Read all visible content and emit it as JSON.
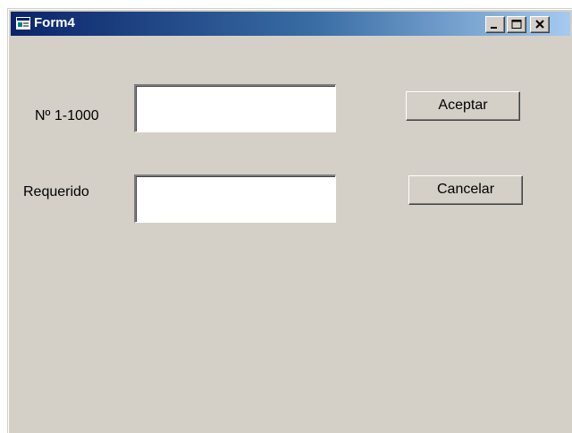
{
  "window": {
    "title": "Form4",
    "icon": "form-window-icon",
    "controls": {
      "minimize": "minimize-icon",
      "maximize": "maximize-icon",
      "close": "close-icon"
    },
    "colors": {
      "face": "#d4d0c8",
      "title_start": "#0a246a",
      "title_end": "#a6caf0"
    }
  },
  "form": {
    "number_label": "Nº 1-1000",
    "number_value": "",
    "required_label": "Requerido",
    "required_value": "",
    "accept_label": "Aceptar",
    "cancel_label": "Cancelar"
  }
}
